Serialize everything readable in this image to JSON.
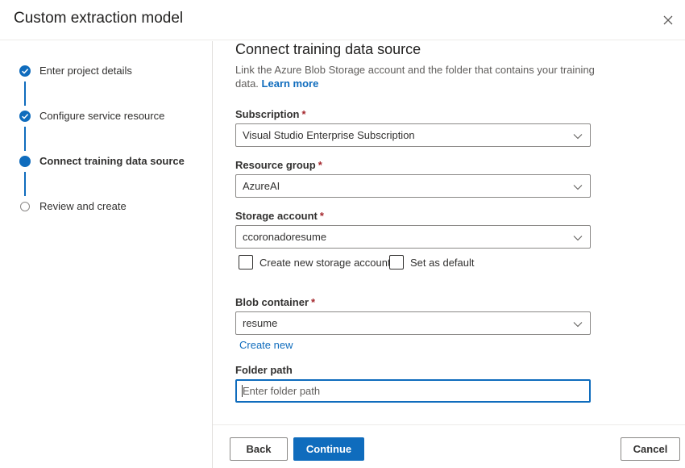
{
  "dialog": {
    "title": "Custom extraction model",
    "close_icon": "close-icon"
  },
  "steps": [
    {
      "label": "Enter project details",
      "state": "done"
    },
    {
      "label": "Configure service resource",
      "state": "done"
    },
    {
      "label": "Connect training data source",
      "state": "current"
    },
    {
      "label": "Review and create",
      "state": "pending"
    }
  ],
  "main": {
    "heading": "Connect training data source",
    "description": "Link the Azure Blob Storage account and the folder that contains your training data.",
    "learn_more": "Learn more",
    "required_marker": "*",
    "subscription": {
      "label": "Subscription",
      "value": "Visual Studio Enterprise Subscription"
    },
    "resource_group": {
      "label": "Resource group",
      "value": "AzureAI"
    },
    "storage_account": {
      "label": "Storage account",
      "value": "ccoronadoresume"
    },
    "create_storage_checkbox": {
      "label": "Create new storage account",
      "checked": false
    },
    "set_default_checkbox": {
      "label": "Set as default",
      "checked": false
    },
    "blob_container": {
      "label": "Blob container",
      "value": "resume"
    },
    "create_new_link": "Create new",
    "folder_path": {
      "label": "Folder path",
      "placeholder": "Enter folder path",
      "value": ""
    }
  },
  "footer": {
    "back": "Back",
    "continue": "Continue",
    "cancel": "Cancel"
  },
  "colors": {
    "accent": "#0f6cbd",
    "required": "#a4262c",
    "border": "#8a8886"
  }
}
